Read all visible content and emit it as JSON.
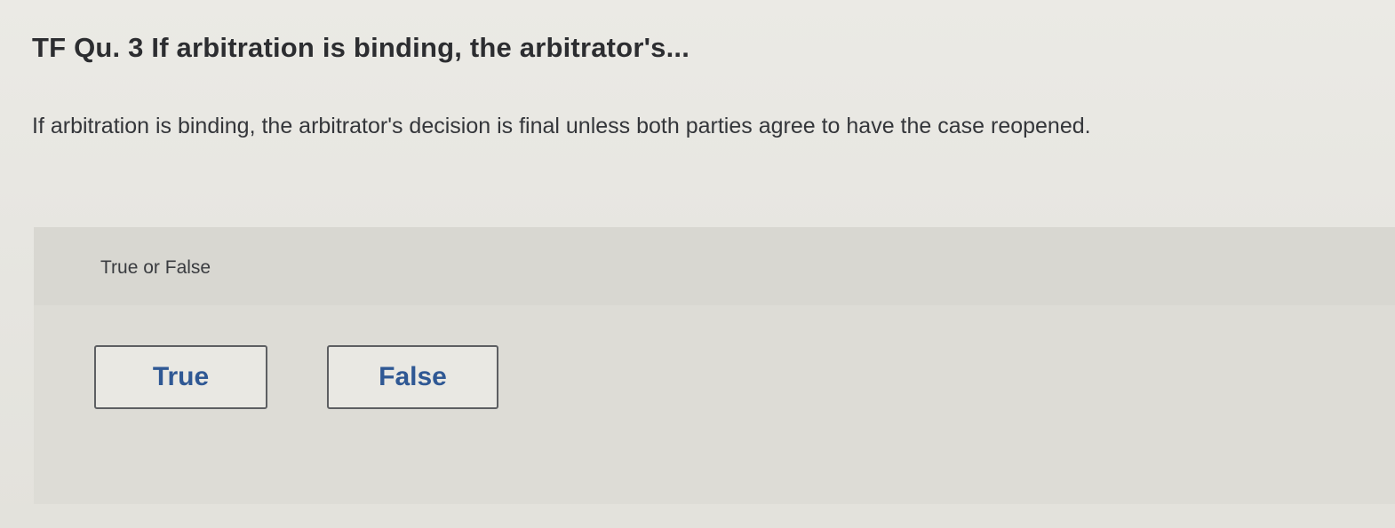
{
  "question": {
    "title": "TF Qu. 3 If arbitration is binding, the arbitrator's...",
    "body": "If arbitration is binding, the arbitrator's decision is final unless both parties agree to have the case reopened."
  },
  "answer": {
    "prompt": "True or False",
    "choices": [
      {
        "label": "True"
      },
      {
        "label": "False"
      }
    ]
  },
  "colors": {
    "choice_text": "#2f5894",
    "choice_border": "#5d5f62",
    "panel_bg": "#dddcd6"
  }
}
